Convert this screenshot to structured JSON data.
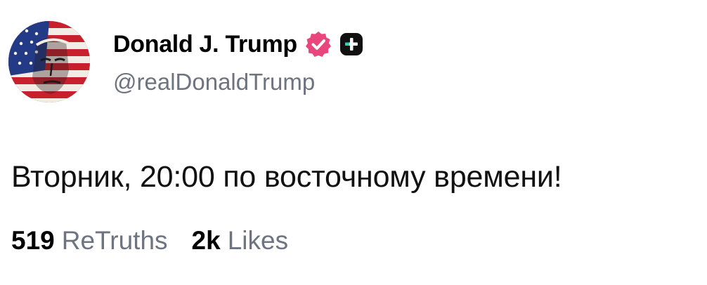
{
  "author": {
    "display_name": "Donald J. Trump",
    "handle": "@realDonaldTrump",
    "avatar_icon": "flag-portrait-avatar",
    "verified_icon": "verified-badge-icon",
    "verified_color": "#e8467c",
    "plus_badge_icon": "plus-badge-icon"
  },
  "post": {
    "text": "Вторник, 20:00 по восточному времени!"
  },
  "stats": {
    "retruths_count": "519",
    "retruths_label": "ReTruths",
    "likes_count": "2k",
    "likes_label": "Likes"
  },
  "colors": {
    "text_primary": "#111111",
    "text_secondary": "#6e7380",
    "background": "#ffffff"
  }
}
